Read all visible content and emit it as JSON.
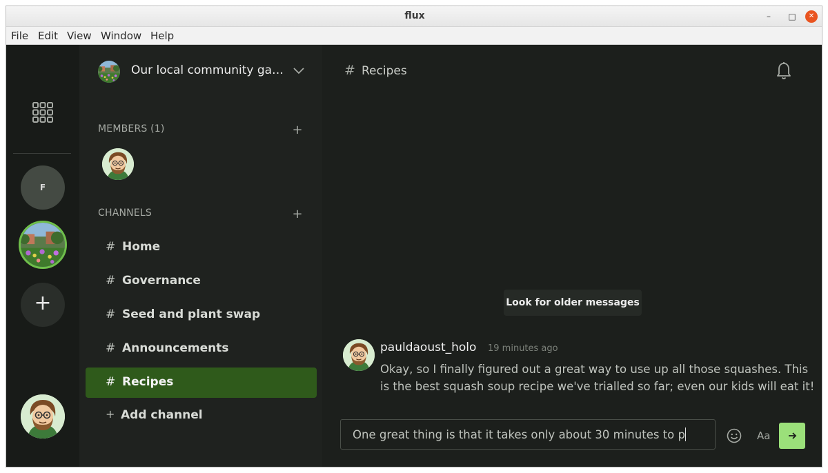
{
  "window": {
    "title": "flux",
    "controls": {
      "minimize": "–",
      "maximize": "□",
      "close": "✕"
    }
  },
  "menubar": {
    "items": [
      "File",
      "Edit",
      "View",
      "Window",
      "Help"
    ]
  },
  "rail": {
    "community_f_initial": "F",
    "add_label": "+"
  },
  "sidebar": {
    "community_name": "Our local community garden",
    "members_label": "MEMBERS (1)",
    "channels_label": "CHANNELS",
    "add_symbol": "+",
    "channels": [
      {
        "name": "Home",
        "active": false
      },
      {
        "name": "Governance",
        "active": false
      },
      {
        "name": "Seed and plant swap",
        "active": false
      },
      {
        "name": "Announcements",
        "active": false
      },
      {
        "name": "Recipes",
        "active": true
      }
    ],
    "hash": "#",
    "add_channel_label": "Add channel"
  },
  "main": {
    "channel_title": "Recipes",
    "older_messages_button": "Look for older messages",
    "message": {
      "author": "pauldaoust_holo",
      "time": "19 minutes ago",
      "body": "Okay, so I finally figured out a great way to use up all those squashes. This is the best squash soup recipe we've trialled so far; even our kids will eat it!"
    },
    "composer": {
      "value": "One great thing is that it takes only about 30 minutes to p"
    },
    "format_button": "Aa"
  },
  "colors": {
    "accent": "#9be07a",
    "active_channel": "#2f5a1b",
    "background": "#1c1f1c",
    "close_button": "#e95420"
  }
}
